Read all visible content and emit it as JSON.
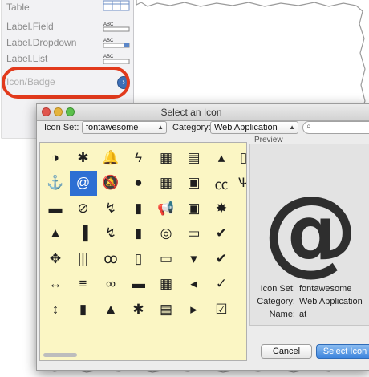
{
  "palette": {
    "items": [
      {
        "label": "Table"
      },
      {
        "label": "Label.Field"
      },
      {
        "label": "Label.Dropdown"
      },
      {
        "label": "Label.List"
      },
      {
        "label": "Icon/Badge"
      }
    ],
    "thumb_text": "ABC"
  },
  "dialog": {
    "title": "Select an Icon",
    "icon_set_label": "Icon Set:",
    "icon_set_value": "fontawesome",
    "category_label": "Category:",
    "category_value": "Web Application",
    "search_placeholder": "",
    "preview_label": "Preview",
    "preview_glyph": "@",
    "info": {
      "icon_set_key": "Icon Set:",
      "icon_set_val": "fontawesome",
      "category_key": "Category:",
      "category_val": "Web Application",
      "name_key": "Name:",
      "name_val": "at"
    },
    "cancel_label": "Cancel",
    "select_label": "Select Icon",
    "selected_icon": "at"
  },
  "icons": [
    [
      "adjust",
      "asterisk",
      "bell",
      "bolt",
      "building",
      "calendar",
      "caret-square-up",
      "cart"
    ],
    [
      "anchor",
      "at",
      "bell-o",
      "bomb",
      "building-o",
      "camera",
      "cc",
      "cutlery"
    ],
    [
      "archive",
      "ban",
      "bell-slash",
      "book",
      "bullhorn",
      "camera-retro",
      "certificate",
      ""
    ],
    [
      "area-chart",
      "bar-chart",
      "bell-slash-o",
      "bookmark",
      "bullseye",
      "car",
      "check",
      ""
    ],
    [
      "arrows",
      "barcode",
      "bicycle",
      "bookmark-o",
      "bus",
      "caret-square-down",
      "check-circle",
      ""
    ],
    [
      "arrows-h",
      "bars",
      "binoculars",
      "briefcase",
      "calculator",
      "caret-square-left",
      "check-circle-o",
      ""
    ],
    [
      "arrows-v",
      "beer",
      "birthday-cake",
      "bug",
      "calendar-grid",
      "caret-square-right",
      "check-square",
      ""
    ]
  ],
  "icon_glyphs": [
    [
      "◑",
      "✱",
      "🔔",
      "ϟ",
      "▦",
      "▤",
      "▴",
      "▯"
    ],
    [
      "⚓",
      "@",
      "🔕",
      "●",
      "▦",
      "▣",
      "㏄",
      "Ѱ"
    ],
    [
      "▬",
      "⊘",
      "↯",
      "▮",
      "📢",
      "▣",
      "✸",
      ""
    ],
    [
      "▲",
      "▐",
      "↯",
      "▮",
      "◎",
      "▭",
      "✔",
      ""
    ],
    [
      "✥",
      "|||",
      "ꝏ",
      "▯",
      "▭",
      "▾",
      "✔",
      ""
    ],
    [
      "↔",
      "≡",
      "∞",
      "▬",
      "▦",
      "◂",
      "✓",
      ""
    ],
    [
      "↕",
      "▮",
      "▲",
      "✱",
      "▤",
      "▸",
      "☑",
      ""
    ]
  ]
}
